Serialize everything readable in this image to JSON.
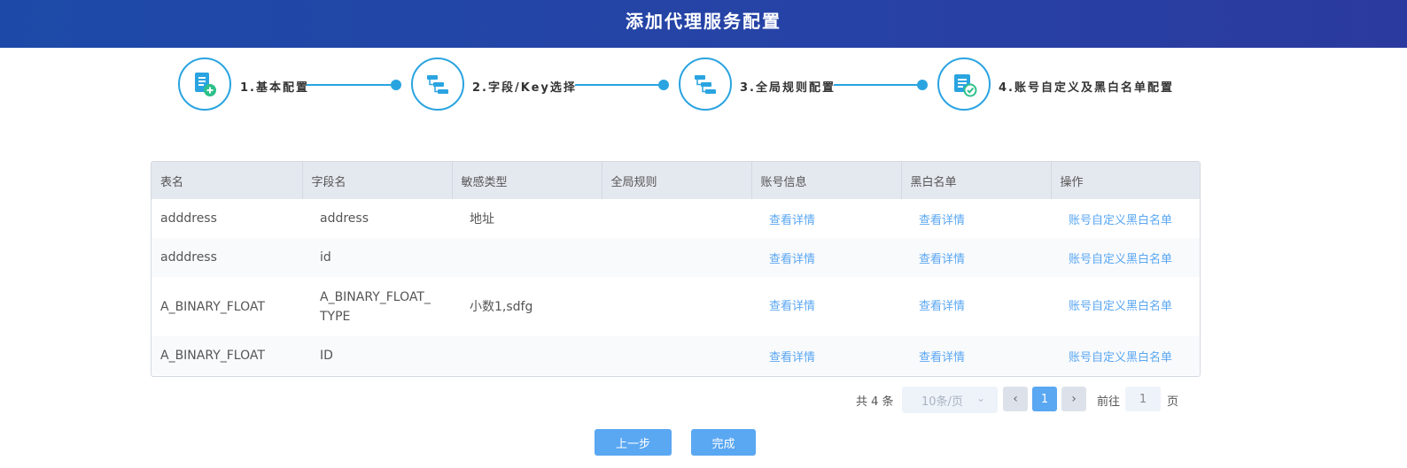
{
  "header": {
    "title": "添加代理服务配置"
  },
  "steps": [
    {
      "label": "1.基本配置",
      "icon": "document-add-icon"
    },
    {
      "label": "2.字段/Key选择",
      "icon": "tree-structure-icon"
    },
    {
      "label": "3.全局规则配置",
      "icon": "tree-structure-icon"
    },
    {
      "label": "4.账号自定义及黑白名单配置",
      "icon": "document-check-icon"
    }
  ],
  "table": {
    "columns": [
      "表名",
      "字段名",
      "敏感类型",
      "全局规则",
      "账号信息",
      "黑白名单",
      "操作"
    ],
    "rows": [
      {
        "table": "adddress",
        "field": "address",
        "type": "地址",
        "rule": "",
        "account": "查看详情",
        "blacklist": "查看详情",
        "action": "账号自定义黑白名单"
      },
      {
        "table": "adddress",
        "field": "id",
        "type": "",
        "rule": "",
        "account": "查看详情",
        "blacklist": "查看详情",
        "action": "账号自定义黑白名单"
      },
      {
        "table": "A_BINARY_FLOAT",
        "field": "A_BINARY_FLOAT_TYPE",
        "type": "小数1,sdfg",
        "rule": "",
        "account": "查看详情",
        "blacklist": "查看详情",
        "action": "账号自定义黑白名单"
      },
      {
        "table": "A_BINARY_FLOAT",
        "field": "ID",
        "type": "",
        "rule": "",
        "account": "查看详情",
        "blacklist": "查看详情",
        "action": "账号自定义黑白名单"
      }
    ]
  },
  "pagination": {
    "total": "共 4 条",
    "page_size": "10条/页",
    "current_page": "1",
    "goto_label": "前往",
    "goto_value": "1",
    "goto_suffix": "页"
  },
  "buttons": {
    "prev": "上一步",
    "finish": "完成"
  },
  "colors": {
    "accent": "#2aa4e0",
    "primary": "#5aa7f2",
    "header": "#2742a6"
  }
}
